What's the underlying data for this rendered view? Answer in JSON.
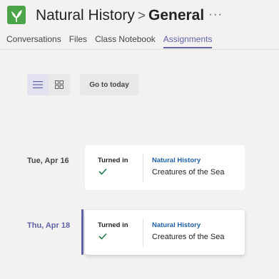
{
  "header": {
    "team_name": "Natural History",
    "separator": ">",
    "channel_name": "General",
    "more_label": "···"
  },
  "tabs": [
    {
      "label": "Conversations",
      "active": false
    },
    {
      "label": "Files",
      "active": false
    },
    {
      "label": "Class Notebook",
      "active": false
    },
    {
      "label": "Assignments",
      "active": true
    }
  ],
  "toolbar": {
    "view_mode": "list",
    "go_to_today_label": "Go to today"
  },
  "assignments": [
    {
      "day": "Tue, Apr 16",
      "is_today": false,
      "status": "Turned in",
      "class_name": "Natural History",
      "title": "Creatures of the Sea"
    },
    {
      "day": "Thu, Apr 18",
      "is_today": true,
      "status": "Turned in",
      "class_name": "Natural History",
      "title": "Creatures of the Sea"
    }
  ],
  "colors": {
    "accent": "#6264a7",
    "check": "#237b4b",
    "class_link": "#1f5fa8",
    "team_logo": "#4ca448"
  }
}
